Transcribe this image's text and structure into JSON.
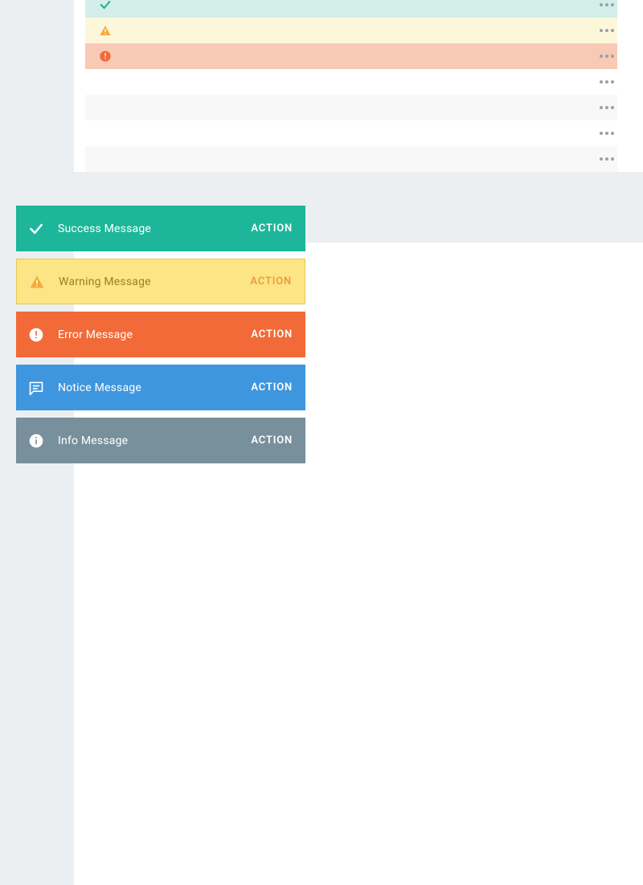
{
  "colors": {
    "success": "#1db69a",
    "warning_bg": "#fce585",
    "warning_border": "#e7c853",
    "warning_text": "#9a7f29",
    "warning_icon": "#f4a93e",
    "error": "#f26a37",
    "notice": "#3e96de",
    "info": "#78909c"
  },
  "stripes": [
    {
      "kind": "success",
      "icon": "check-icon"
    },
    {
      "kind": "warning",
      "icon": "warning-triangle-icon"
    },
    {
      "kind": "error",
      "icon": "exclamation-circle-icon"
    },
    {
      "kind": "plain"
    },
    {
      "kind": "plain-alt"
    },
    {
      "kind": "plain"
    },
    {
      "kind": "plain-alt"
    }
  ],
  "banners": [
    {
      "kind": "success",
      "icon": "check-icon",
      "label": "Success Message",
      "action": "ACTION"
    },
    {
      "kind": "warning",
      "icon": "warning-triangle-icon",
      "label": "Warning Message",
      "action": "ACTION"
    },
    {
      "kind": "error",
      "icon": "exclamation-circle-icon",
      "label": "Error Message",
      "action": "ACTION"
    },
    {
      "kind": "notice",
      "icon": "message-bubble-icon",
      "label": "Notice Message",
      "action": "ACTION"
    },
    {
      "kind": "info",
      "icon": "info-circle-icon",
      "label": "Info Message",
      "action": "ACTION"
    }
  ]
}
